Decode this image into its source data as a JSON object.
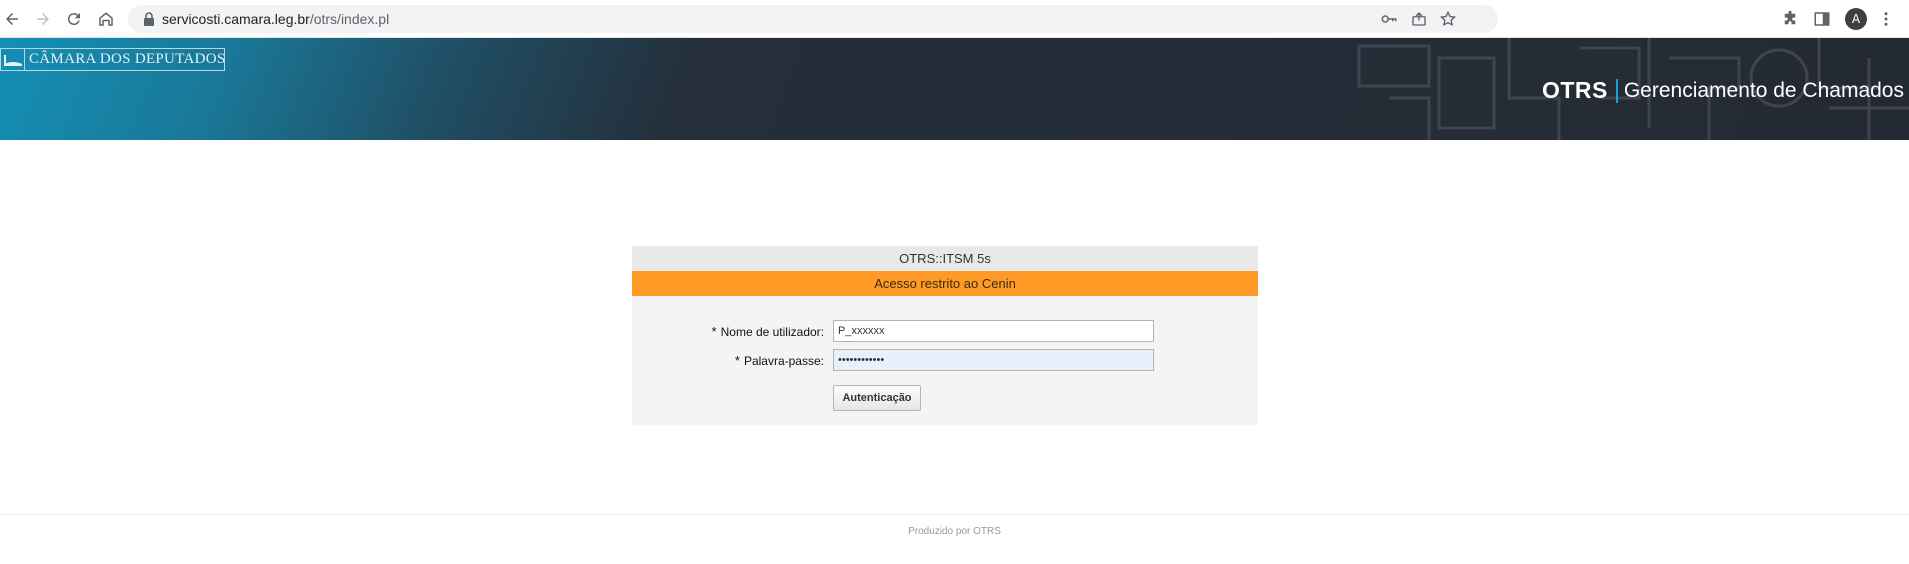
{
  "browser": {
    "url_host": "servicosti.camara.leg.br",
    "url_path": "/otrs/index.pl",
    "profile_initial": "A",
    "icons": [
      "back-icon",
      "forward-icon",
      "reload-icon",
      "home-icon",
      "lock-icon",
      "key-icon",
      "share-icon",
      "star-icon",
      "extensions-icon",
      "side-panel-icon",
      "menu-icon"
    ]
  },
  "header": {
    "org_logo_text": "CÂMARA DOS DEPUTADOS",
    "brand_name": "OTRS",
    "brand_subtitle": "Gerenciamento de Chamados",
    "colors": {
      "gradient_start": "#138fb5",
      "gradient_end": "#242a33",
      "brand_separator": "#1aa0d0"
    }
  },
  "login": {
    "title": "OTRS::ITSM 5s",
    "notice": "Acesso restrito ao Cenin",
    "notice_color": "#ff9a26",
    "required_marker": "*",
    "username_label": "Nome de utilizador:",
    "username_value": "P_xxxxxx",
    "password_label": "Palavra-passe:",
    "password_value": "••••••••••••",
    "submit_label": "Autenticação"
  },
  "footer": {
    "text": "Produzido por OTRS"
  }
}
